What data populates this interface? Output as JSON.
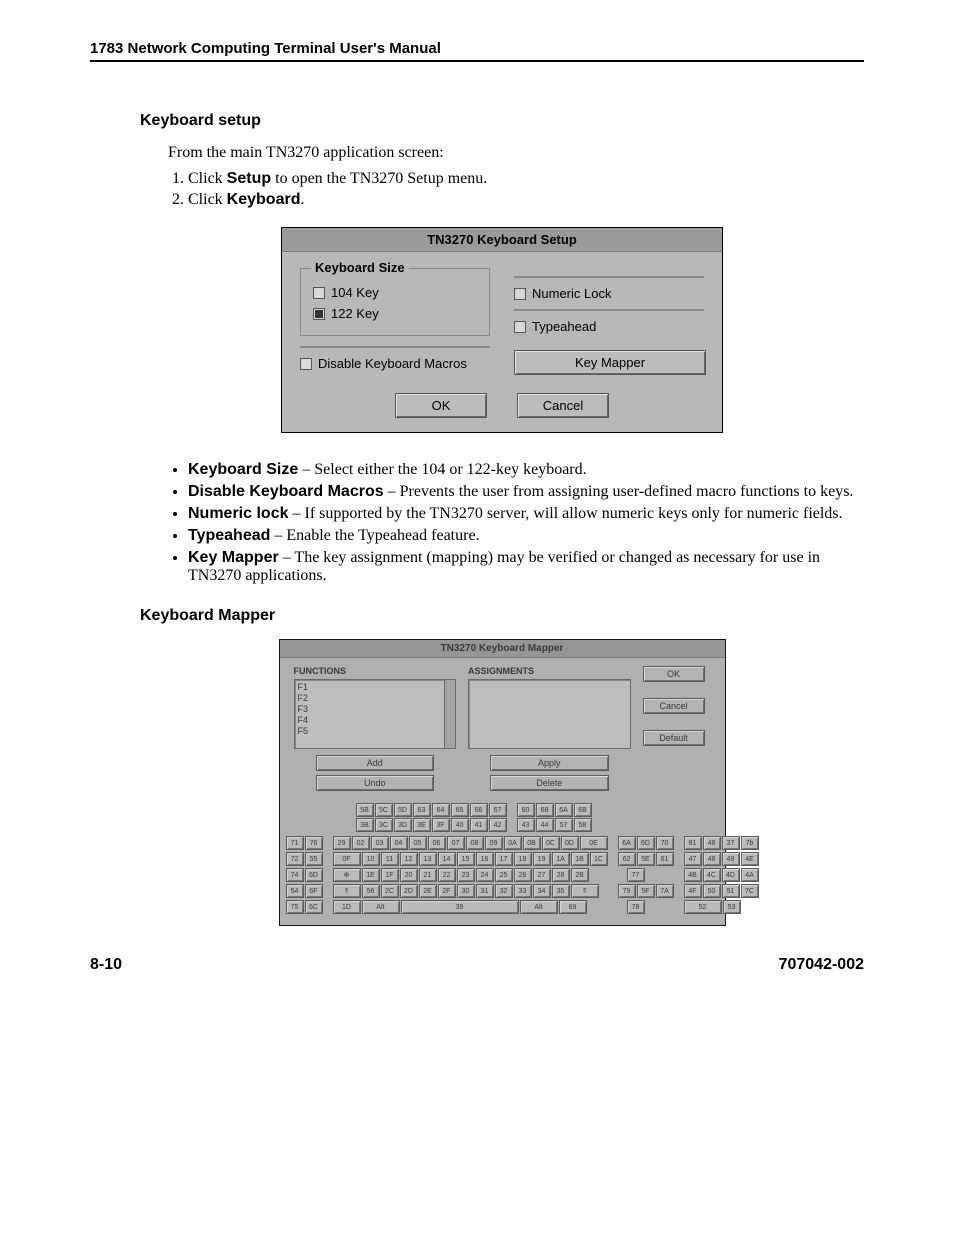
{
  "header": {
    "title": "1783 Network Computing Terminal User's Manual"
  },
  "section1": {
    "heading": "Keyboard setup",
    "intro": "From the main TN3270 application screen:",
    "steps": [
      {
        "pre": "Click ",
        "bold": "Setup",
        "post": " to open the TN3270 Setup menu."
      },
      {
        "pre": "Click ",
        "bold": "Keyboard",
        "post": "."
      }
    ]
  },
  "dialog1": {
    "title": "TN3270 Keyboard Setup",
    "fieldset_legend": "Keyboard Size",
    "opt_104": "104 Key",
    "opt_122": "122 Key",
    "chk_disable": "Disable Keyboard Macros",
    "chk_numlock": "Numeric Lock",
    "chk_typeahead": "Typeahead",
    "btn_mapper": "Key Mapper",
    "btn_ok": "OK",
    "btn_cancel": "Cancel"
  },
  "bullets": [
    {
      "term": "Keyboard Size",
      "desc": " – Select either the 104 or 122-key keyboard."
    },
    {
      "term": "Disable Keyboard Macros",
      "desc": " – Prevents the user from assigning user-defined macro functions to keys."
    },
    {
      "term": "Numeric lock",
      "desc": " – If supported by the TN3270 server, will allow numeric keys only for numeric fields."
    },
    {
      "term": "Typeahead",
      "desc": " – Enable the Typeahead feature."
    },
    {
      "term": "Key Mapper",
      "desc": " – The key assignment (mapping) may be verified or changed as necessary for use in TN3270 applications."
    }
  ],
  "section2": {
    "heading": "Keyboard Mapper"
  },
  "dialog2": {
    "title": "TN3270 Keyboard Mapper",
    "label_functions": "FUNCTIONS",
    "label_assignments": "ASSIGNMENTS",
    "func_items": [
      "F1",
      "F2",
      "F3",
      "F4",
      "F5"
    ],
    "btn_add": "Add",
    "btn_undo": "Undo",
    "btn_apply": "Apply",
    "btn_delete": "Delete",
    "btn_ok": "OK",
    "btn_cancel": "Cancel",
    "btn_default": "Default",
    "frow_top": [
      "5B",
      "5C",
      "5D",
      "63",
      "64",
      "65",
      "66",
      "67",
      "",
      "60",
      "68",
      "6A",
      "6B"
    ],
    "frow_bot": [
      "3B",
      "3C",
      "3D",
      "3E",
      "3F",
      "40",
      "41",
      "42",
      "",
      "43",
      "44",
      "57",
      "58"
    ],
    "left_pairs": [
      [
        "71",
        "76"
      ],
      [
        "72",
        "55"
      ],
      [
        "74",
        "6D"
      ],
      [
        "54",
        "6F"
      ],
      [
        "75",
        "6C"
      ]
    ],
    "row1": [
      "29",
      "02",
      "03",
      "04",
      "05",
      "06",
      "07",
      "08",
      "09",
      "0A",
      "0B",
      "0C",
      "0D",
      "0E"
    ],
    "row2": [
      "0F",
      "10",
      "11",
      "12",
      "13",
      "14",
      "15",
      "16",
      "17",
      "18",
      "19",
      "1A",
      "1B"
    ],
    "row2_tall": "1C",
    "row3": [
      "⊕",
      "1E",
      "1F",
      "20",
      "21",
      "22",
      "23",
      "24",
      "25",
      "26",
      "27",
      "28",
      "2B"
    ],
    "row4": [
      "⇑",
      "56",
      "2C",
      "2D",
      "2E",
      "2F",
      "30",
      "31",
      "32",
      "33",
      "34",
      "35",
      "⇑"
    ],
    "row5": [
      "1D",
      "Alt",
      "39",
      "Alt",
      "69"
    ],
    "nav_rows": [
      [
        "6A",
        "6D",
        "70"
      ],
      [
        "62",
        "5E",
        "61"
      ],
      [
        "77"
      ],
      [
        "79",
        "5F",
        "7A"
      ],
      [
        "78"
      ]
    ],
    "numpad_rows": [
      [
        "81",
        "48",
        "37",
        "7b"
      ],
      [
        "47",
        "48",
        "49",
        "4E"
      ],
      [
        "4B",
        "4C",
        "4D",
        "4A"
      ],
      [
        "4F",
        "50",
        "51"
      ],
      [
        "52",
        "53"
      ]
    ],
    "numpad_tall": "7C"
  },
  "footer": {
    "left": "8-10",
    "right": "707042-002"
  }
}
